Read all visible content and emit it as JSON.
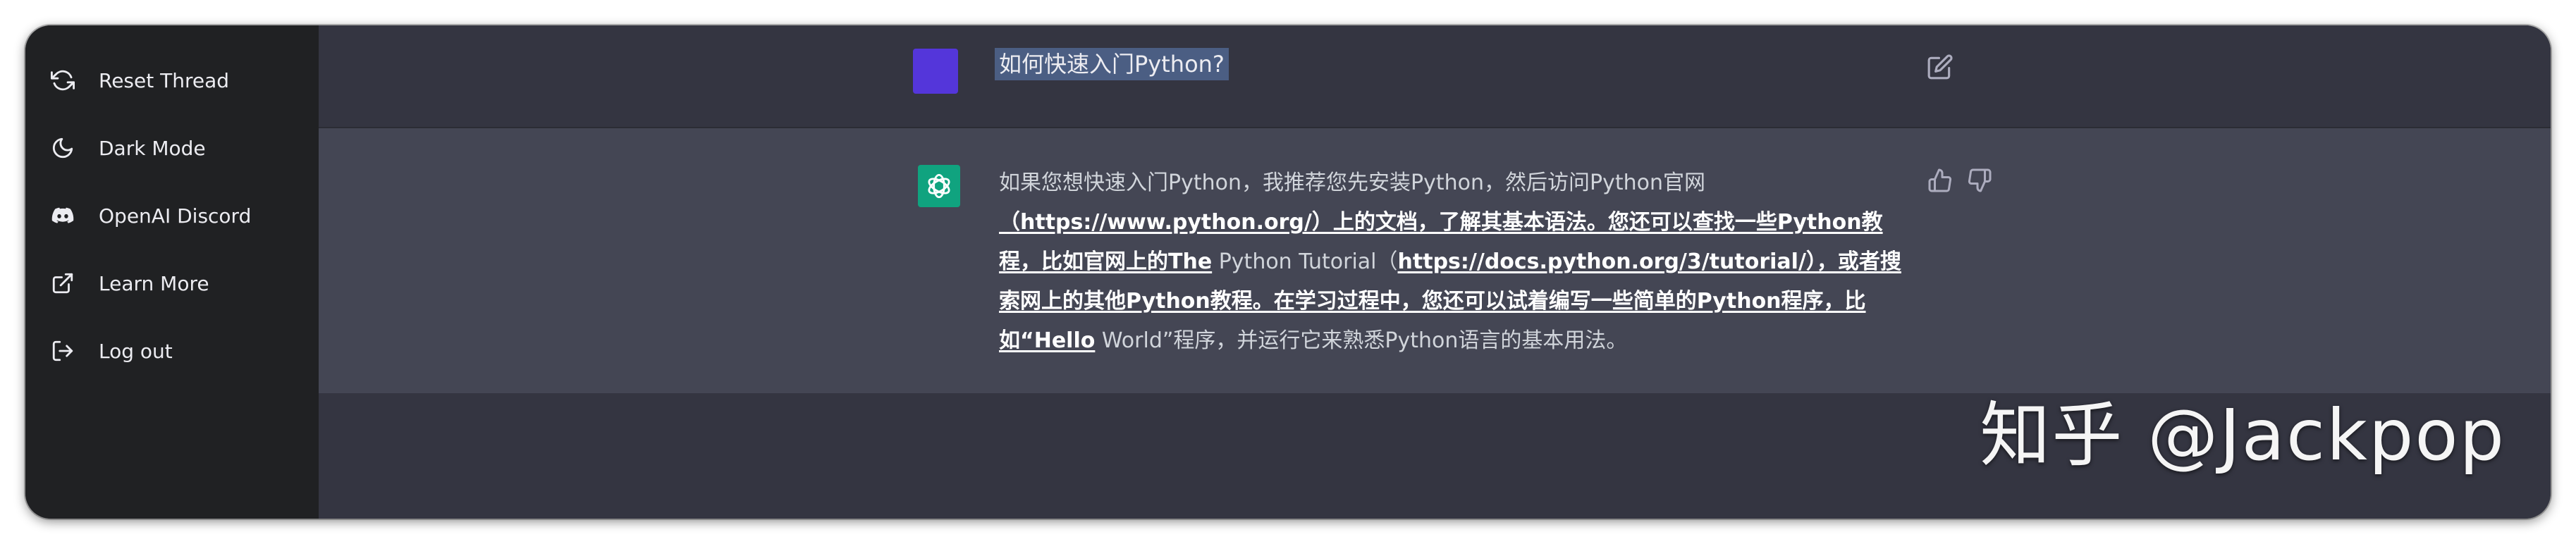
{
  "sidebar": {
    "items": [
      {
        "label": "Reset Thread",
        "icon": "refresh-icon"
      },
      {
        "label": "Dark Mode",
        "icon": "moon-icon"
      },
      {
        "label": "OpenAI Discord",
        "icon": "discord-icon"
      },
      {
        "label": "Learn More",
        "icon": "external-link-icon"
      },
      {
        "label": "Log out",
        "icon": "logout-icon"
      }
    ]
  },
  "thread": {
    "user_message": "如何快速入门Python?",
    "assistant_message": {
      "parts": [
        {
          "text": "如果您想快速入门Python，我推荐您先安装Python，然后访问Python官网",
          "bold": false
        },
        {
          "text": "（https://www.python.org/）上的文档，了解其基本语法。您还可以查找一些Python教程，比如官网上的The",
          "bold": true
        },
        {
          "text": " Python Tutorial（",
          "bold": false
        },
        {
          "text": "https://docs.python.org/3/tutorial/），或者搜索网上的其他Python教程。在学习过程中，您还可以试着编写一些简单的Python程序，比如“Hello",
          "bold": true
        },
        {
          "text": " World”程序，并运行它来熟悉Python语言的基本用法。",
          "bold": false
        }
      ]
    }
  },
  "watermark": "知乎 @Jackpop",
  "colors": {
    "sidebar_bg": "#202123",
    "main_bg": "#343541",
    "assistant_row_bg": "#444654",
    "user_avatar": "#5436da",
    "assistant_avatar": "#10a37f"
  }
}
